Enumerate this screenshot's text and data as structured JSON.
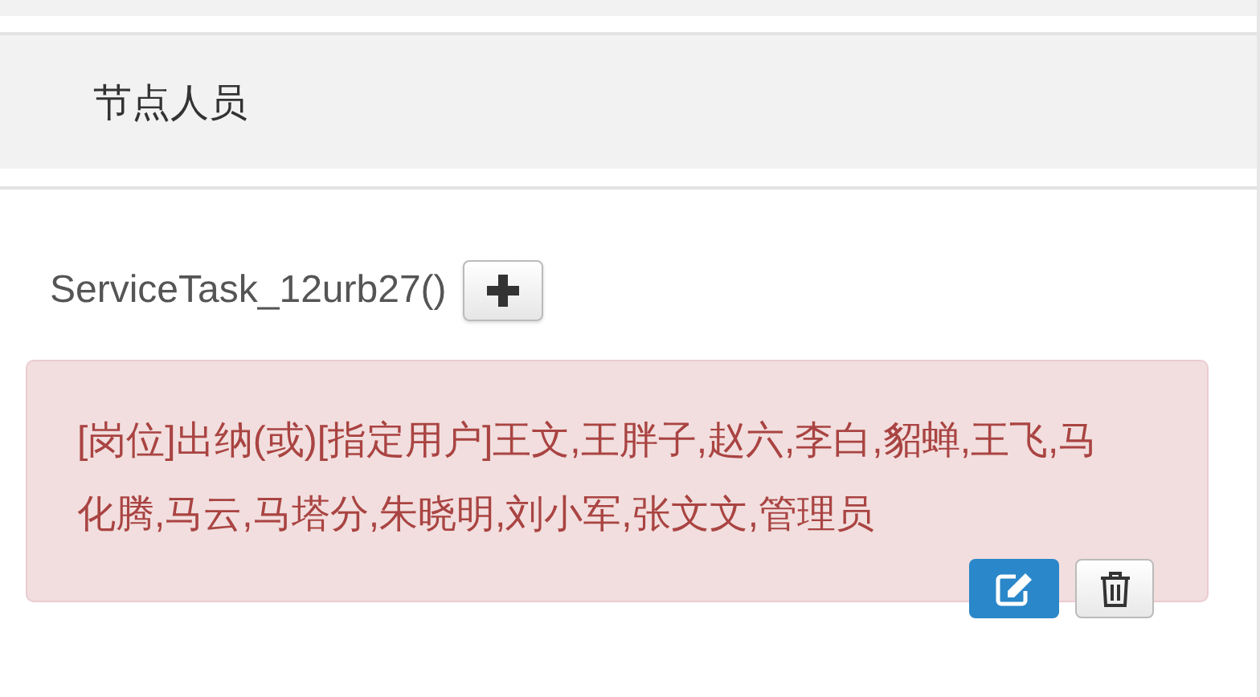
{
  "panel": {
    "title": "节点人员"
  },
  "task": {
    "label": "ServiceTask_12urb27()"
  },
  "assignment": {
    "text": "[岗位]出纳(或)[指定用户]王文,王胖子,赵六,李白,貂蝉,王飞,马化腾,马云,马塔分,朱晓明,刘小军,张文文,管理员"
  }
}
